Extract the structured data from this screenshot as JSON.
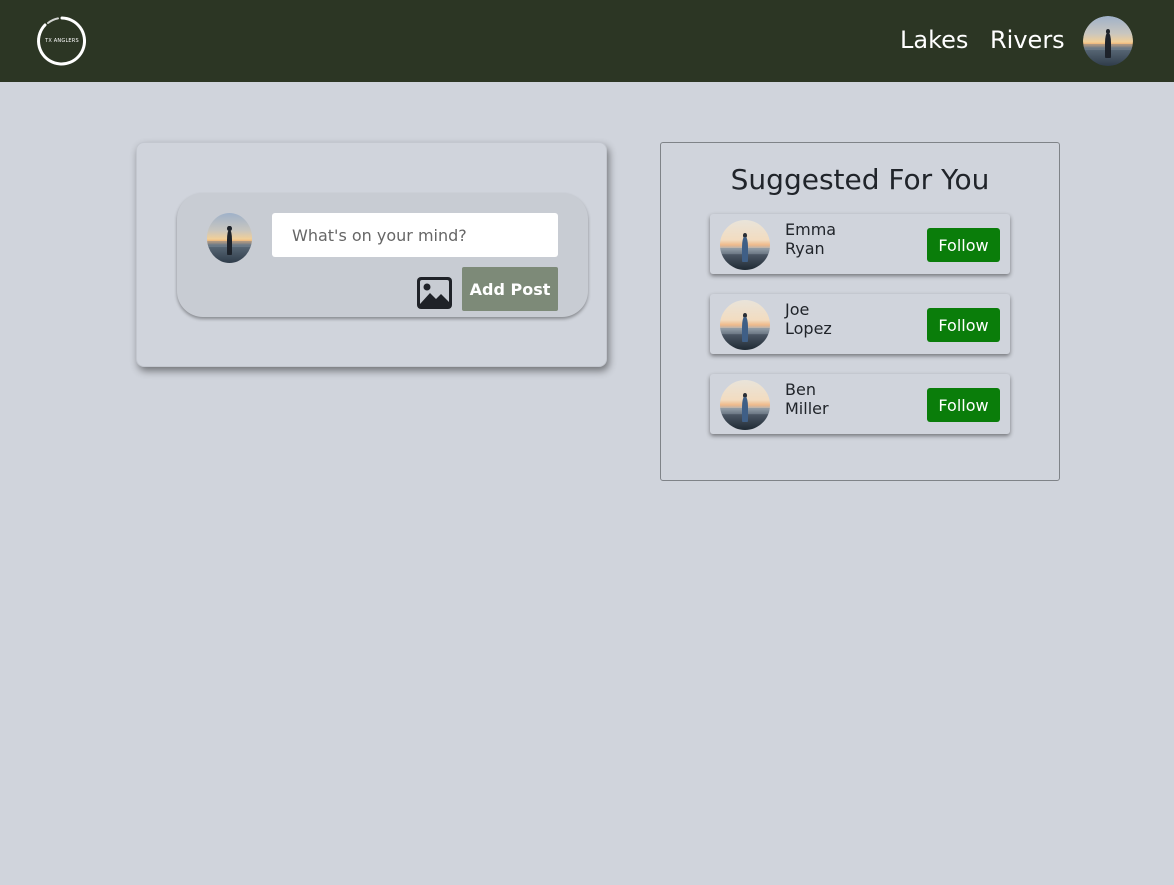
{
  "header": {
    "logo_text": "TX ANGLERS",
    "nav": [
      {
        "label": "Lakes"
      },
      {
        "label": "Rivers"
      }
    ]
  },
  "composer": {
    "placeholder": "What's on your mind?",
    "add_post_label": "Add Post"
  },
  "suggestions": {
    "title": "Suggested For You",
    "items": [
      {
        "first": "Emma",
        "last": "Ryan",
        "button": "Follow"
      },
      {
        "first": "Joe",
        "last": "Lopez",
        "button": "Follow"
      },
      {
        "first": "Ben",
        "last": "Miller",
        "button": "Follow"
      }
    ]
  },
  "colors": {
    "header_bg": "#2c3624",
    "page_bg": "#d0d4dc",
    "add_post_bg": "#7d8a78",
    "follow_bg": "#0a7d0a"
  }
}
